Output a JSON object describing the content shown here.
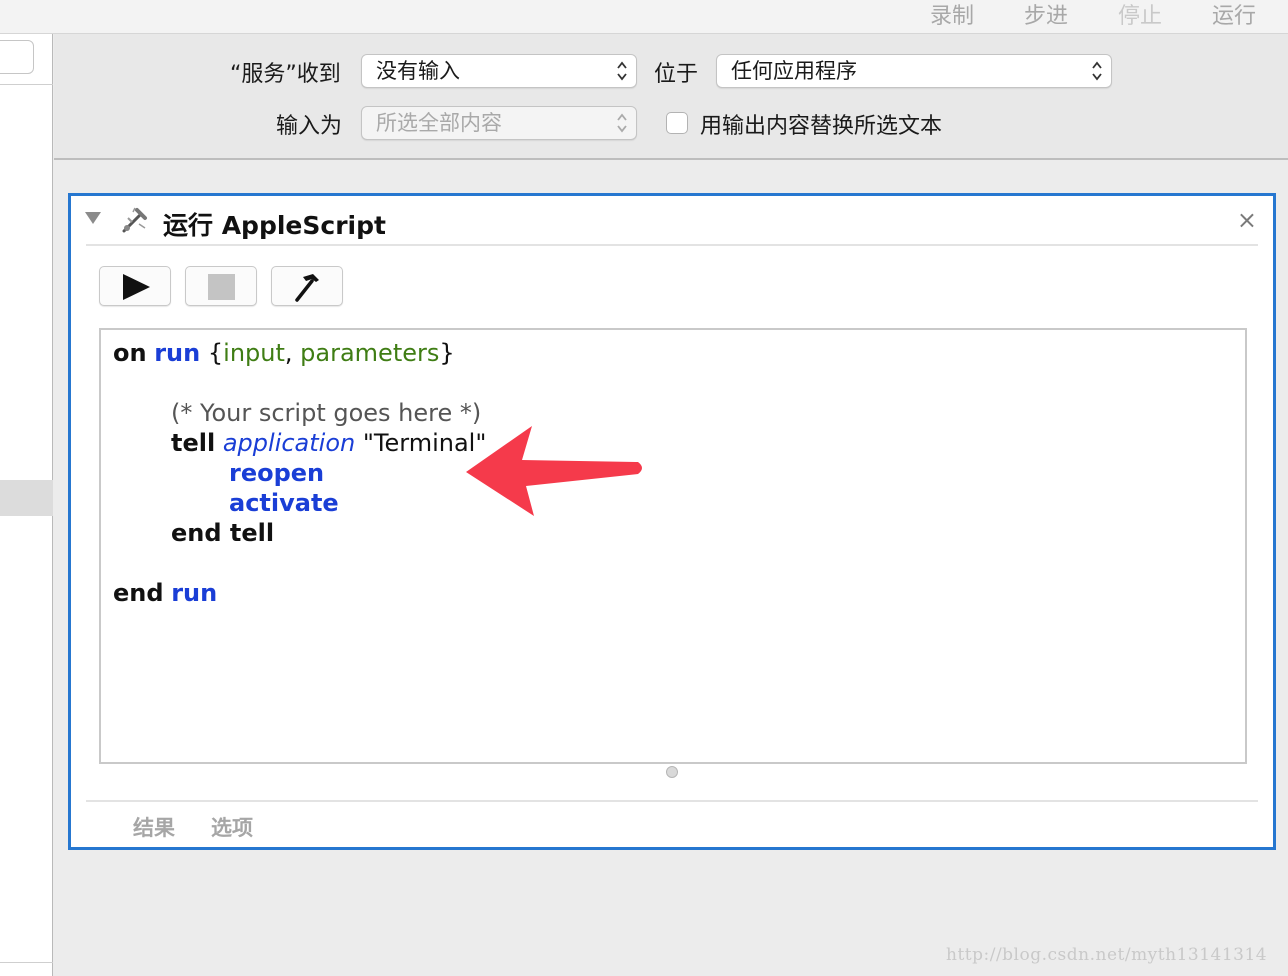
{
  "toolbar": {
    "record": "录制",
    "step": "步进",
    "stop": "停止",
    "run": "运行"
  },
  "config": {
    "receives_label": "“服务”收到",
    "receives_value": "没有输入",
    "in_label": "位于",
    "in_value": "任何应用程序",
    "input_is_label": "输入为",
    "input_is_value": "所选全部内容",
    "replace_label": "用输出内容替换所选文本",
    "replace_checked": false
  },
  "action": {
    "title": "运行 AppleScript",
    "close_glyph": "×",
    "accent_color": "#2677d0",
    "code": {
      "l1": {
        "on": "on",
        "run": "run",
        "open": "{",
        "input": "input",
        "comma": ", ",
        "parameters": "parameters",
        "close": "}"
      },
      "l2": {
        "comment": "(* Your script goes here *)"
      },
      "l3": {
        "tell": "tell",
        "application": "application",
        "string": "\"Terminal\""
      },
      "l4": {
        "reopen": "reopen"
      },
      "l5": {
        "activate": "activate"
      },
      "l6": {
        "end_tell": "end tell"
      },
      "l7": {
        "end": "end",
        "run": "run"
      }
    },
    "tabs": {
      "results": "结果",
      "options": "选项"
    }
  },
  "annotation": {
    "arrow_color": "#f53a4b"
  },
  "watermark": "http://blog.csdn.net/myth13141314"
}
